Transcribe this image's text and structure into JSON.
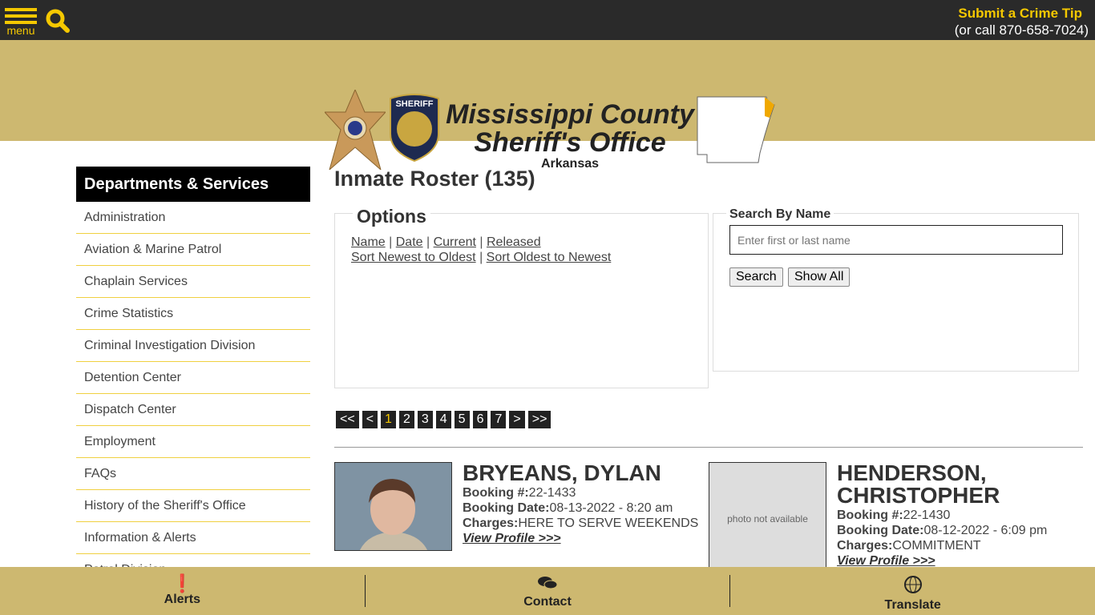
{
  "topbar": {
    "menu_label": "menu",
    "tip_title": "Submit a Crime Tip",
    "tip_phone": "(or call 870-658-7024)"
  },
  "banner": {
    "line1": "Mississippi County",
    "line2": "Sheriff's Office",
    "state": "Arkansas",
    "patch_text": "SHERIFF"
  },
  "sidebar": {
    "title": "Departments & Services",
    "items": [
      "Administration",
      "Aviation & Marine Patrol",
      "Chaplain Services",
      "Crime Statistics",
      "Criminal Investigation Division",
      "Detention Center",
      "Dispatch Center",
      "Employment",
      "FAQs",
      "History of the Sheriff's Office",
      "Information & Alerts",
      "Patrol Division"
    ]
  },
  "main": {
    "title": "Inmate Roster (135)",
    "options": {
      "legend": "Options",
      "name": "Name",
      "date": "Date",
      "current": "Current",
      "released": "Released",
      "newest": "Sort Newest to Oldest",
      "oldest": "Sort Oldest to Newest"
    },
    "search": {
      "legend": "Search By Name",
      "placeholder": "Enter first or last name",
      "search_label": "Search",
      "show_all_label": "Show All"
    },
    "pager": [
      "<<",
      "<",
      "1",
      "2",
      "3",
      "4",
      "5",
      "6",
      "7",
      ">",
      ">>"
    ],
    "current_page": "1",
    "inmates": [
      {
        "name": "BRYEANS, DYLAN",
        "booking_label": "Booking #:",
        "booking": "22-1433",
        "date_label": "Booking Date:",
        "date": "08-13-2022 - 8:20 am",
        "charges_label": "Charges:",
        "charges": "HERE TO SERVE WEEKENDS",
        "link": "View Profile >>>"
      },
      {
        "name": "HENDERSON, CHRISTOPHER",
        "booking_label": "Booking #:",
        "booking": "22-1430",
        "date_label": "Booking Date:",
        "date": "08-12-2022 - 6:09 pm",
        "charges_label": "Charges:",
        "charges": "COMMITMENT",
        "link": "View Profile >>>",
        "photo_text": "photo not available"
      }
    ]
  },
  "footer": {
    "alerts": "Alerts",
    "contact": "Contact",
    "translate": "Translate"
  },
  "colors": {
    "accent": "#f5c800",
    "banner": "#cdb870",
    "topbar": "#2a2a2a"
  }
}
